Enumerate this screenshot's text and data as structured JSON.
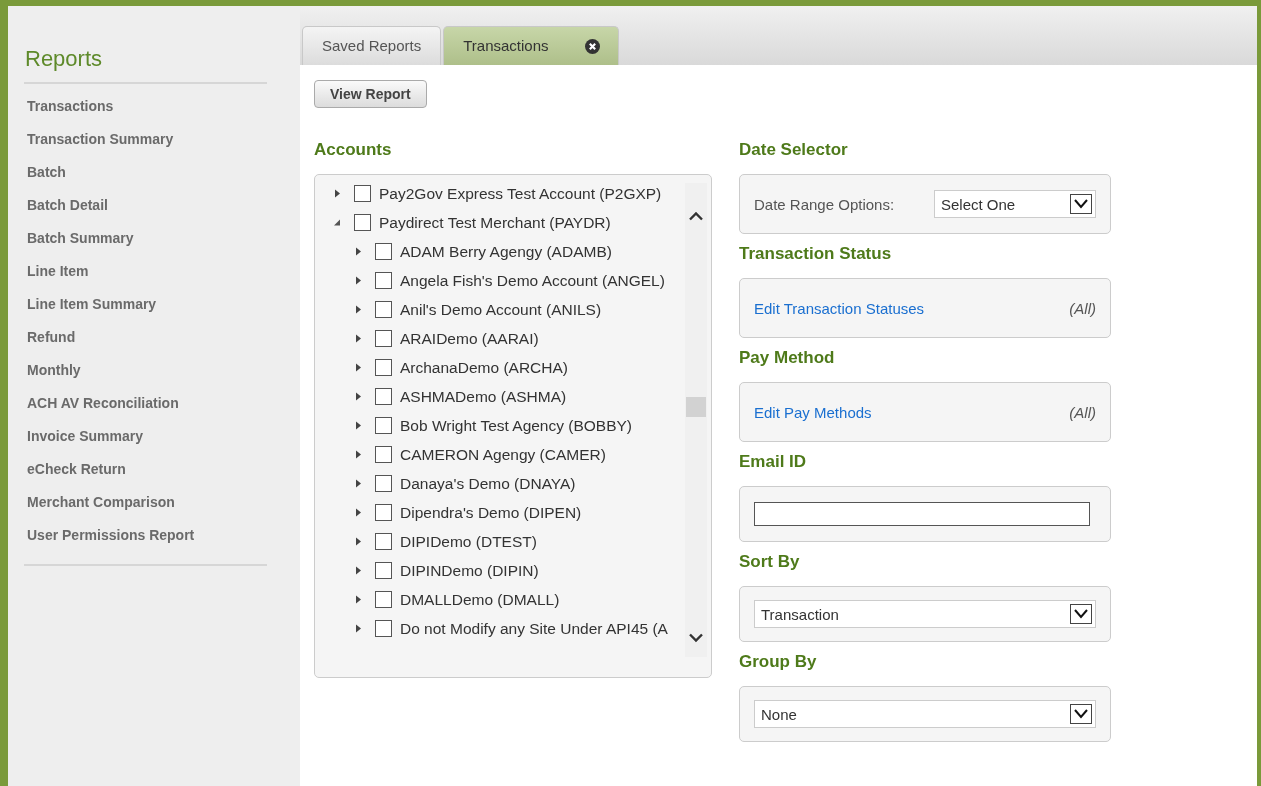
{
  "sidebar": {
    "title": "Reports",
    "items": [
      {
        "label": "Transactions"
      },
      {
        "label": "Transaction Summary"
      },
      {
        "label": "Batch"
      },
      {
        "label": "Batch Detail"
      },
      {
        "label": "Batch Summary"
      },
      {
        "label": "Line Item"
      },
      {
        "label": "Line Item Summary"
      },
      {
        "label": "Refund"
      },
      {
        "label": "Monthly"
      },
      {
        "label": "ACH AV Reconciliation"
      },
      {
        "label": "Invoice Summary"
      },
      {
        "label": "eCheck Return"
      },
      {
        "label": "Merchant Comparison"
      },
      {
        "label": "User Permissions Report"
      }
    ]
  },
  "tabs": [
    {
      "label": "Saved Reports",
      "selected": false,
      "closable": false
    },
    {
      "label": "Transactions",
      "selected": true,
      "closable": true
    }
  ],
  "view_report_button": "View Report",
  "accounts": {
    "title": "Accounts",
    "tree": [
      {
        "label": "Pay2Gov Express Test Account (P2GXP)",
        "checked": false,
        "expanded": false
      },
      {
        "label": "Paydirect Test Merchant (PAYDR)",
        "checked": false,
        "expanded": true,
        "children": [
          {
            "label": "ADAM Berry Agengy (ADAMB)",
            "checked": false,
            "expanded": false
          },
          {
            "label": "Angela Fish's Demo Account (ANGEL)",
            "checked": false,
            "expanded": false
          },
          {
            "label": "Anil's Demo Account (ANILS)",
            "checked": false,
            "expanded": false
          },
          {
            "label": "ARAIDemo (AARAI)",
            "checked": false,
            "expanded": false
          },
          {
            "label": "ArchanaDemo (ARCHA)",
            "checked": false,
            "expanded": false
          },
          {
            "label": "ASHMADemo (ASHMA)",
            "checked": false,
            "expanded": false
          },
          {
            "label": "Bob Wright Test Agency (BOBBY)",
            "checked": false,
            "expanded": false
          },
          {
            "label": "CAMERON Agengy (CAMER)",
            "checked": false,
            "expanded": false
          },
          {
            "label": "Danaya's Demo (DNAYA)",
            "checked": false,
            "expanded": false
          },
          {
            "label": "Dipendra's Demo (DIPEN)",
            "checked": false,
            "expanded": false
          },
          {
            "label": "DIPIDemo (DTEST)",
            "checked": false,
            "expanded": false
          },
          {
            "label": "DIPINDemo (DIPIN)",
            "checked": false,
            "expanded": false
          },
          {
            "label": "DMALLDemo (DMALL)",
            "checked": false,
            "expanded": false
          },
          {
            "label": "Do not Modify any Site Under API45 (A",
            "checked": false,
            "expanded": false
          }
        ]
      }
    ]
  },
  "date_selector": {
    "title": "Date Selector",
    "label": "Date Range Options:",
    "value": "Select One"
  },
  "transaction_status": {
    "title": "Transaction Status",
    "link": "Edit Transaction Statuses",
    "summary": "(All)"
  },
  "pay_method": {
    "title": "Pay Method",
    "link": "Edit Pay Methods",
    "summary": "(All)"
  },
  "email_id": {
    "title": "Email ID"
  },
  "sort_by": {
    "title": "Sort By",
    "value": "Transaction"
  },
  "group_by": {
    "title": "Group By",
    "value": "None"
  }
}
